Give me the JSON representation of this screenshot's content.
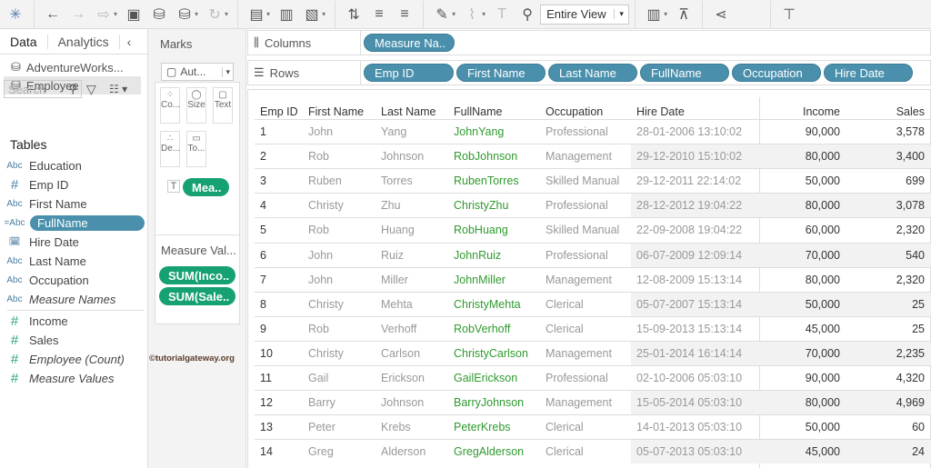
{
  "toolbar": {
    "view_select": "Entire View"
  },
  "data_pane": {
    "tabs": [
      "Data",
      "Analytics"
    ],
    "sources": [
      "AdventureWorks...",
      "Employee"
    ],
    "search_placeholder": "Search",
    "tables_label": "Tables",
    "fields": [
      {
        "type": "Abc",
        "name": "Education"
      },
      {
        "type": "#",
        "name": "Emp ID"
      },
      {
        "type": "Abc",
        "name": "First Name"
      },
      {
        "type": "=Abc",
        "name": "FullName"
      },
      {
        "type": "date",
        "name": "Hire Date"
      },
      {
        "type": "Abc",
        "name": "Last Name"
      },
      {
        "type": "Abc",
        "name": "Occupation"
      },
      {
        "type": "Abc",
        "name": "Measure Names"
      },
      {
        "type": "#",
        "name": "Income"
      },
      {
        "type": "#",
        "name": "Sales"
      },
      {
        "type": "#",
        "name": "Employee (Count)"
      },
      {
        "type": "#",
        "name": "Measure Values"
      }
    ]
  },
  "marks": {
    "title": "Marks",
    "type": "Aut...",
    "buttons": [
      "Co...",
      "Size",
      "Text",
      "De...",
      "To..."
    ],
    "text_pill": "Mea.."
  },
  "measure_values": {
    "title": "Measure Val...",
    "pills": [
      "SUM(Inco..",
      "SUM(Sale.."
    ]
  },
  "watermark": "©tutorialgateway.org",
  "shelves": {
    "columns_label": "Columns",
    "columns": [
      "Measure Na.."
    ],
    "rows_label": "Rows",
    "rows": [
      "Emp ID",
      "First Name",
      "Last Name",
      "FullName",
      "Occupation",
      "Hire Date"
    ]
  },
  "table": {
    "headers": [
      "Emp ID",
      "First Name",
      "Last Name",
      "FullName",
      "Occupation",
      "Hire Date",
      "Income",
      "Sales"
    ],
    "rows": [
      [
        "1",
        "John",
        "Yang",
        "JohnYang",
        "Professional",
        "28-01-2006 13:10:02",
        "90,000",
        "3,578"
      ],
      [
        "2",
        "Rob",
        "Johnson",
        "RobJohnson",
        "Management",
        "29-12-2010 15:10:02",
        "80,000",
        "3,400"
      ],
      [
        "3",
        "Ruben",
        "Torres",
        "RubenTorres",
        "Skilled Manual",
        "29-12-2011 22:14:02",
        "50,000",
        "699"
      ],
      [
        "4",
        "Christy",
        "Zhu",
        "ChristyZhu",
        "Professional",
        "28-12-2012 19:04:22",
        "80,000",
        "3,078"
      ],
      [
        "5",
        "Rob",
        "Huang",
        "RobHuang",
        "Skilled Manual",
        "22-09-2008 19:04:22",
        "60,000",
        "2,320"
      ],
      [
        "6",
        "John",
        "Ruiz",
        "JohnRuiz",
        "Professional",
        "06-07-2009 12:09:14",
        "70,000",
        "540"
      ],
      [
        "7",
        "John",
        "Miller",
        "JohnMiller",
        "Management",
        "12-08-2009 15:13:14",
        "80,000",
        "2,320"
      ],
      [
        "8",
        "Christy",
        "Mehta",
        "ChristyMehta",
        "Clerical",
        "05-07-2007 15:13:14",
        "50,000",
        "25"
      ],
      [
        "9",
        "Rob",
        "Verhoff",
        "RobVerhoff",
        "Clerical",
        "15-09-2013 15:13:14",
        "45,000",
        "25"
      ],
      [
        "10",
        "Christy",
        "Carlson",
        "ChristyCarlson",
        "Management",
        "25-01-2014 16:14:14",
        "70,000",
        "2,235"
      ],
      [
        "11",
        "Gail",
        "Erickson",
        "GailErickson",
        "Professional",
        "02-10-2006 05:03:10",
        "90,000",
        "4,320"
      ],
      [
        "12",
        "Barry",
        "Johnson",
        "BarryJohnson",
        "Management",
        "15-05-2014 05:03:10",
        "80,000",
        "4,969"
      ],
      [
        "13",
        "Peter",
        "Krebs",
        "PeterKrebs",
        "Clerical",
        "14-01-2013 05:03:10",
        "50,000",
        "60"
      ],
      [
        "14",
        "Greg",
        "Alderson",
        "GregAlderson",
        "Clerical",
        "05-07-2013 05:03:10",
        "45,000",
        "24"
      ]
    ]
  }
}
